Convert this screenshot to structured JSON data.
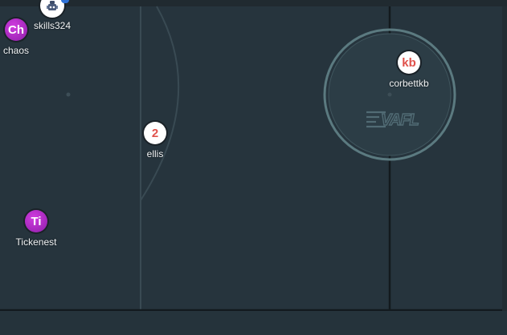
{
  "colors": {
    "pitch": "#26343d",
    "lines": "#394a53",
    "dark_lines": "#131a1e",
    "circle_ring": "#6a8a8f",
    "token_white": "#ffffff",
    "token_text_red": "#e0524c",
    "token_purple": "#b02dc6"
  },
  "pitch": {
    "center_logo": "VAFL"
  },
  "players": [
    {
      "id": "skills324",
      "name": "skills324",
      "token_text": "",
      "token_icon": "robot-avatar-icon"
    },
    {
      "id": "chaos",
      "name": "chaos",
      "token_text": "Ch",
      "token_style": "purple"
    },
    {
      "id": "ellis",
      "name": "ellis",
      "token_text": "2",
      "token_style": "white"
    },
    {
      "id": "tickenest",
      "name": "Tickenest",
      "token_text": "Ti",
      "token_style": "purple"
    },
    {
      "id": "corbettkb",
      "name": "corbettkb",
      "token_text": "kb",
      "token_style": "white"
    }
  ]
}
